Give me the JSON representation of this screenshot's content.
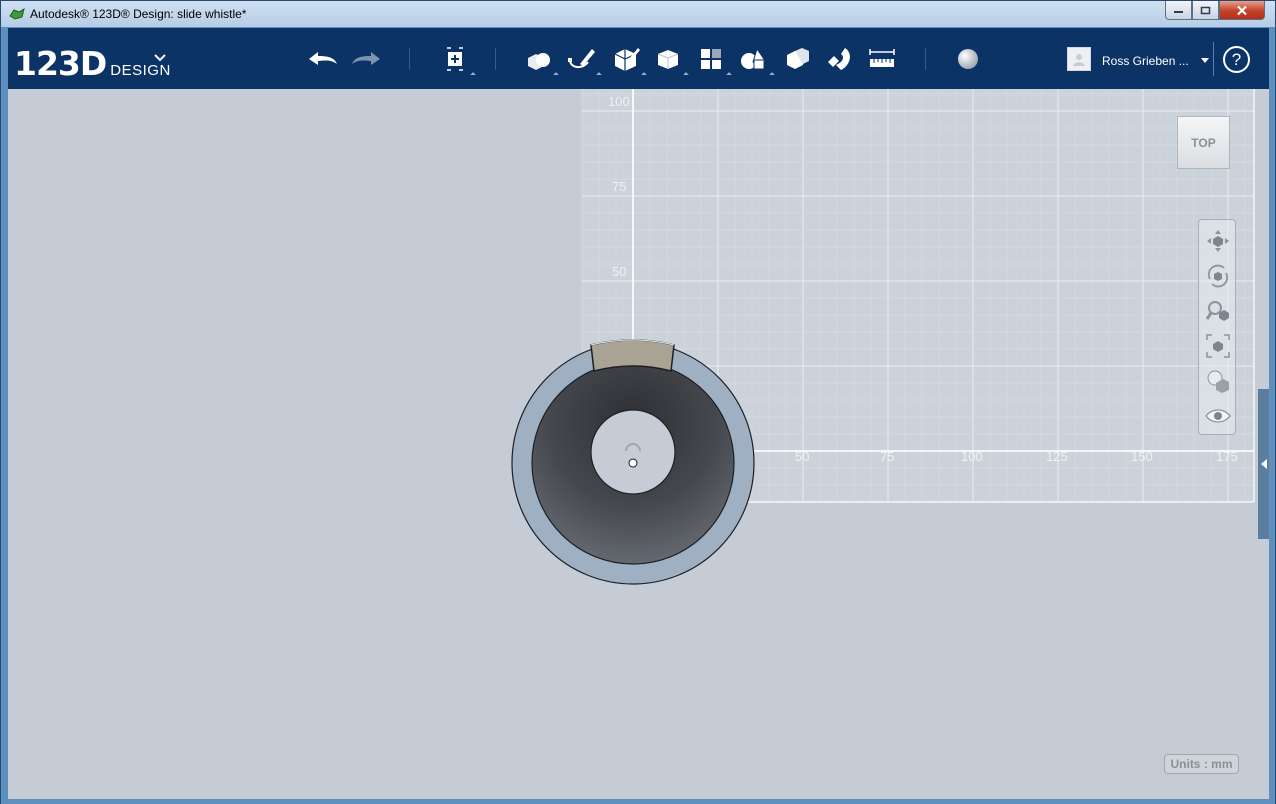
{
  "window": {
    "title": "Autodesk® 123D® Design: slide whistle*"
  },
  "appbar": {
    "logo_main": "123D",
    "logo_sub": "DESIGN",
    "tools": [
      {
        "name": "undo-icon"
      },
      {
        "name": "redo-icon"
      },
      {
        "name": "transform-icon"
      },
      {
        "name": "primitives-icon"
      },
      {
        "name": "sketch-icon"
      },
      {
        "name": "construct-icon"
      },
      {
        "name": "modify-icon"
      },
      {
        "name": "pattern-icon"
      },
      {
        "name": "grouping-icon"
      },
      {
        "name": "combine-icon"
      },
      {
        "name": "snap-icon"
      },
      {
        "name": "measure-icon"
      },
      {
        "name": "material-icon"
      }
    ],
    "user": {
      "name": "Ross Grieben ..."
    },
    "help_label": "?"
  },
  "viewport": {
    "viewcube_label": "TOP",
    "grid": {
      "y_labels": [
        "100",
        "75",
        "50"
      ],
      "x_labels": [
        "50",
        "75",
        "100",
        "125",
        "150",
        "175"
      ]
    },
    "nav_tools": [
      {
        "name": "pan-icon"
      },
      {
        "name": "orbit-icon"
      },
      {
        "name": "zoom-icon"
      },
      {
        "name": "fit-icon"
      },
      {
        "name": "view-mode-icon"
      },
      {
        "name": "visibility-eye-icon"
      }
    ],
    "units_label": "Units : mm"
  },
  "colors": {
    "appbar": "#0c3366",
    "viewport_bg": "#c6ccd5",
    "grid_line": "#dfe3ea",
    "disc_outer": "#9fb0c2",
    "disc_inner": "#4a4d53",
    "slot": "#a9a393"
  }
}
